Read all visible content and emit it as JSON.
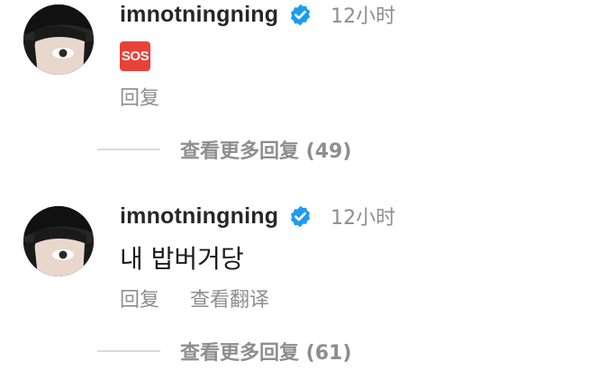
{
  "comments": [
    {
      "username": "imnotningning",
      "verified": true,
      "time": "12小时",
      "emoji": "SOS",
      "actions": [
        "回复"
      ],
      "more_replies": "查看更多回复 (49)"
    },
    {
      "username": "imnotningning",
      "verified": true,
      "time": "12小时",
      "text": "내 밥버거당",
      "actions": [
        "回复",
        "查看翻译"
      ],
      "more_replies": "查看更多回复 (61)"
    }
  ],
  "colors": {
    "verified_blue": "#1d9bf0",
    "sos_red": "#e8413a",
    "secondary_text": "#8e8e8e"
  }
}
